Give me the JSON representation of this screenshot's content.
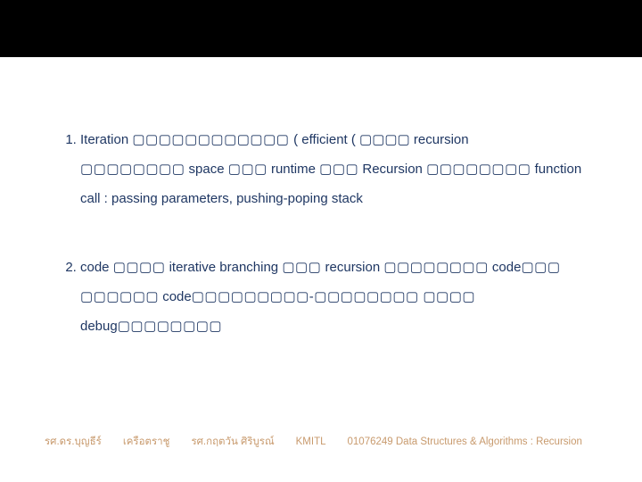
{
  "title_bar_color": "#000000",
  "bullets": [
    {
      "lines": [
        {
          "segments": [
            {
              "t": "Iteration ",
              "cls": "kw"
            },
            {
              "t": "▢▢▢▢▢▢▢▢▢▢▢▢ ",
              "cls": "tofu"
            },
            {
              "t": "( efficient ( ▢▢▢▢ ",
              "cls": "kw"
            },
            {
              "t": "recursion",
              "cls": "kw"
            }
          ]
        },
        {
          "segments": [
            {
              "t": "▢▢▢▢▢▢▢▢",
              "cls": "tofu"
            },
            {
              "t": " space ",
              "cls": "kw"
            },
            {
              "t": "▢▢▢",
              "cls": "tofu"
            },
            {
              "t": " runtime ",
              "cls": "kw"
            },
            {
              "t": "▢▢▢",
              "cls": "tofu"
            },
            {
              "t": " Recursion ",
              "cls": "kw"
            },
            {
              "t": "▢▢▢▢▢▢▢▢",
              "cls": "tofu"
            },
            {
              "t": " function",
              "cls": "kw"
            }
          ]
        },
        {
          "segments": [
            {
              "t": "call : passing parameters, pushing-poping stack",
              "cls": "kw"
            }
          ]
        }
      ]
    },
    {
      "lines": [
        {
          "segments": [
            {
              "t": "code ",
              "cls": "kw"
            },
            {
              "t": "▢▢▢▢",
              "cls": "tofu"
            },
            {
              "t": " iterative branching ",
              "cls": "kw"
            },
            {
              "t": "▢▢▢",
              "cls": "tofu"
            },
            {
              "t": " recursion ",
              "cls": "kw"
            },
            {
              "t": "▢▢▢▢▢▢▢▢",
              "cls": "tofu"
            },
            {
              "t": " code",
              "cls": "kw"
            },
            {
              "t": "▢▢▢",
              "cls": "tofu"
            }
          ]
        },
        {
          "segments": [
            {
              "t": "▢▢▢▢▢▢",
              "cls": "tofu"
            },
            {
              "t": " code",
              "cls": "kw"
            },
            {
              "t": "▢▢▢▢▢▢▢▢▢-▢▢▢▢▢▢▢▢ ▢▢▢▢ ",
              "cls": "tofu"
            },
            {
              "t": "debug",
              "cls": "kw"
            },
            {
              "t": "▢▢▢▢▢▢▢▢",
              "cls": "tofu"
            }
          ]
        }
      ]
    }
  ],
  "footer": {
    "seg1": "รศ.ดร.บุญธีร์",
    "seg2": "เครือตราชู",
    "seg3": "รศ.กฤตวัน  ศิริบูรณ์",
    "seg4": "KMITL",
    "seg5": "01076249 Data Structures & Algorithms : Recursion"
  }
}
